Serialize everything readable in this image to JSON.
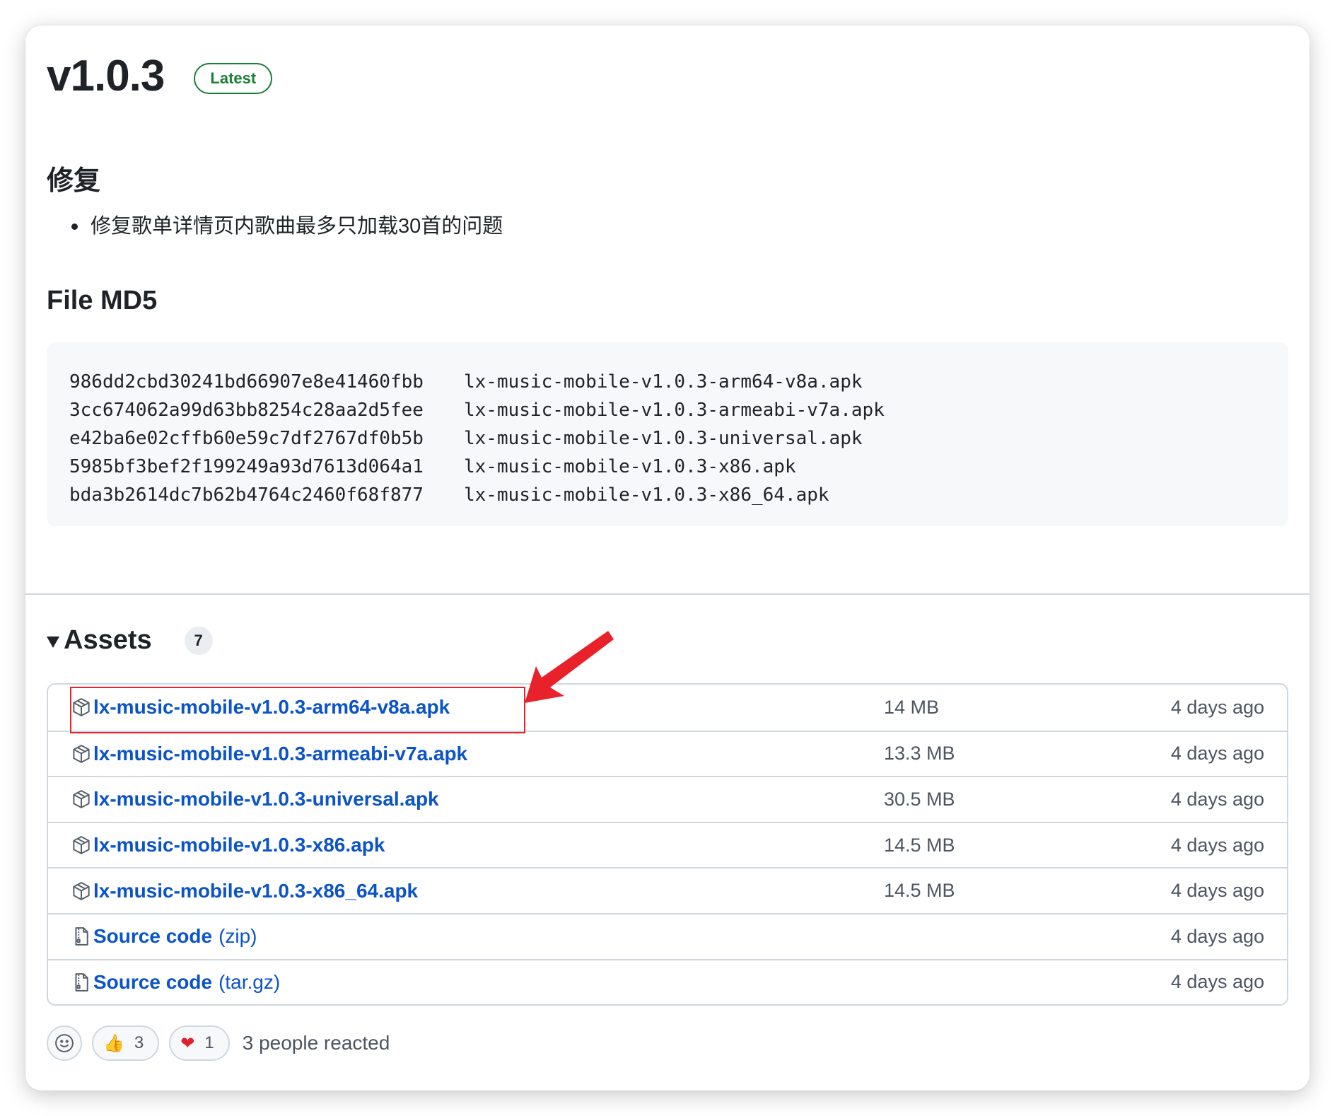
{
  "release": {
    "title": "v1.0.3",
    "badge": "Latest"
  },
  "notes": {
    "fix_heading": "修复",
    "fix_items": [
      "修复歌单详情页内歌曲最多只加载30首的问题"
    ],
    "md5_heading": "File MD5",
    "md5_rows": [
      {
        "hash": "986dd2cbd30241bd66907e8e41460fbb",
        "file": "lx-music-mobile-v1.0.3-arm64-v8a.apk"
      },
      {
        "hash": "3cc674062a99d63bb8254c28aa2d5fee",
        "file": "lx-music-mobile-v1.0.3-armeabi-v7a.apk"
      },
      {
        "hash": "e42ba6e02cffb60e59c7df2767df0b5b",
        "file": "lx-music-mobile-v1.0.3-universal.apk"
      },
      {
        "hash": "5985bf3bef2f199249a93d7613d064a1",
        "file": "lx-music-mobile-v1.0.3-x86.apk"
      },
      {
        "hash": "bda3b2614dc7b62b4764c2460f68f877",
        "file": "lx-music-mobile-v1.0.3-x86_64.apk"
      }
    ]
  },
  "assets": {
    "title": "Assets",
    "count": "7",
    "items": [
      {
        "name": "lx-music-mobile-v1.0.3-arm64-v8a.apk",
        "suffix": "",
        "size": "14 MB",
        "date": "4 days ago",
        "icon": "package-icon"
      },
      {
        "name": "lx-music-mobile-v1.0.3-armeabi-v7a.apk",
        "suffix": "",
        "size": "13.3 MB",
        "date": "4 days ago",
        "icon": "package-icon"
      },
      {
        "name": "lx-music-mobile-v1.0.3-universal.apk",
        "suffix": "",
        "size": "30.5 MB",
        "date": "4 days ago",
        "icon": "package-icon"
      },
      {
        "name": "lx-music-mobile-v1.0.3-x86.apk",
        "suffix": "",
        "size": "14.5 MB",
        "date": "4 days ago",
        "icon": "package-icon"
      },
      {
        "name": "lx-music-mobile-v1.0.3-x86_64.apk",
        "suffix": "",
        "size": "14.5 MB",
        "date": "4 days ago",
        "icon": "package-icon"
      },
      {
        "name": "Source code",
        "suffix": "(zip)",
        "size": "",
        "date": "4 days ago",
        "icon": "file-zip-icon"
      },
      {
        "name": "Source code",
        "suffix": "(tar.gz)",
        "size": "",
        "date": "4 days ago",
        "icon": "file-zip-icon"
      }
    ]
  },
  "reactions": {
    "thumbs_up_count": "3",
    "heart_count": "1",
    "summary": "3 people reacted"
  },
  "colors": {
    "link": "#0a53c9",
    "latest_green": "#1a7f37",
    "annotation_red": "#e8212b"
  }
}
